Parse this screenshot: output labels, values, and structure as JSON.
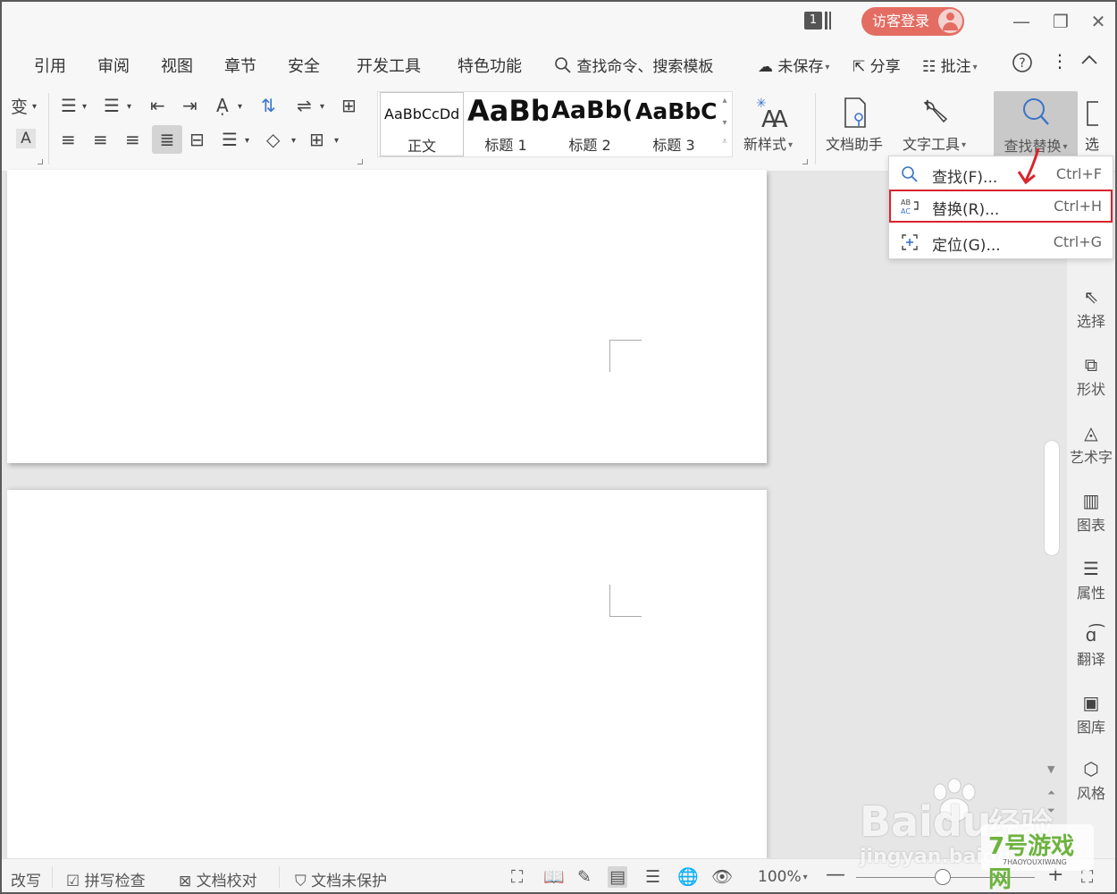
{
  "titlebar": {
    "window_count": "1",
    "guest_login": "访客登录",
    "controls": {
      "minimize": "—",
      "restore": "❐",
      "close": "✕"
    }
  },
  "menu": {
    "tabs": [
      "引用",
      "审阅",
      "视图",
      "章节",
      "安全",
      "开发工具",
      "特色功能"
    ],
    "search_placeholder": "查找命令、搜索模板",
    "unsaved": "未保存",
    "share": "分享",
    "comment": "批注"
  },
  "ribbon": {
    "partial_left_1": "变",
    "partial_left_2": "A",
    "styles": [
      {
        "sample": "AaBbCcDd",
        "name": "正文"
      },
      {
        "sample": "AaBb",
        "name": "标题 1"
      },
      {
        "sample": "AaBb(",
        "name": "标题 2"
      },
      {
        "sample": "AaBbC",
        "name": "标题 3"
      }
    ],
    "new_style": "新样式",
    "doc_assistant": "文档助手",
    "text_tools": "文字工具",
    "find_replace": "查找替换",
    "select_partial": "选"
  },
  "dropdown": {
    "items": [
      {
        "label": "查找(F)...",
        "shortcut": "Ctrl+F",
        "icon": "search-icon"
      },
      {
        "label": "替换(R)...",
        "shortcut": "Ctrl+H",
        "icon": "replace-icon"
      },
      {
        "label": "定位(G)...",
        "shortcut": "Ctrl+G",
        "icon": "locate-icon"
      }
    ],
    "highlight_color": "#d9242c"
  },
  "sidepanel": {
    "items": [
      "选择",
      "形状",
      "艺术字",
      "图表",
      "属性",
      "翻译",
      "图库",
      "风格"
    ]
  },
  "statusbar": {
    "revise": "改写",
    "spell_check": "拼写检查",
    "doc_proof": "文档校对",
    "doc_protect": "文档未保护",
    "zoom": "100%"
  },
  "watermark": {
    "baidu": "Baidu",
    "jingyan_cn": "经验",
    "jingyan_url": "jingyan.baidu.com",
    "site": "7号游戏网",
    "site_pinyin": "7HAOYOUXIWANG"
  },
  "colors": {
    "guest_button": "#e46d63",
    "accent_blue": "#3a73c9",
    "arrow_red": "#d9242c"
  }
}
